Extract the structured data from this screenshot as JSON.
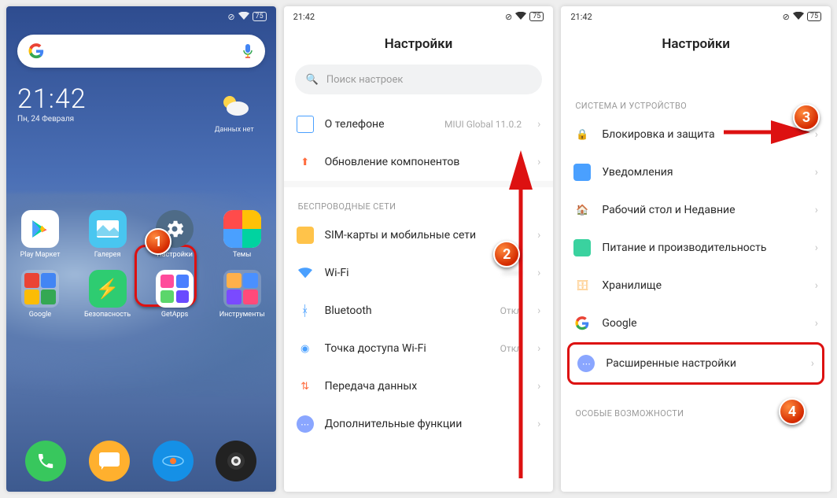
{
  "status": {
    "time": "21:42",
    "battery": "75"
  },
  "home": {
    "clock": "21:42",
    "date": "Пн, 24 Февраля",
    "weather_label": "Данных нет",
    "apps_row1": [
      {
        "label": "Play Маркет"
      },
      {
        "label": "Галерея"
      },
      {
        "label": "Настройки"
      },
      {
        "label": "Темы"
      }
    ],
    "apps_row2": [
      {
        "label": "Google"
      },
      {
        "label": "Безопасность"
      },
      {
        "label": "GetApps"
      },
      {
        "label": "Инструменты"
      }
    ]
  },
  "s2": {
    "title": "Настройки",
    "search_placeholder": "Поиск настроек",
    "about_label": "О телефоне",
    "about_value": "MIUI Global 11.0.2",
    "update_label": "Обновление компонентов",
    "sec_wireless": "БЕСПРОВОДНЫЕ СЕТИ",
    "sim_label": "SIM-карты и мобильные сети",
    "wifi_label": "Wi-Fi",
    "bt_label": "Bluetooth",
    "bt_value": "Откл",
    "hotspot_label": "Точка доступа Wi-Fi",
    "hotspot_value": "Откл",
    "data_label": "Передача данных",
    "more_label": "Дополнительные функции"
  },
  "s3": {
    "title": "Настройки",
    "sec_system": "СИСТЕМА И УСТРОЙСТВО",
    "lock_label": "Блокировка и защита",
    "notif_label": "Уведомления",
    "desk_label": "Рабочий стол и Недавние",
    "power_label": "Питание и производительность",
    "storage_label": "Хранилище",
    "google_label": "Google",
    "advanced_label": "Расширенные настройки",
    "sec_special": "ОСОБЫЕ ВОЗМОЖНОСТИ"
  },
  "badges": {
    "b1": "1",
    "b2": "2",
    "b3": "3",
    "b4": "4"
  }
}
